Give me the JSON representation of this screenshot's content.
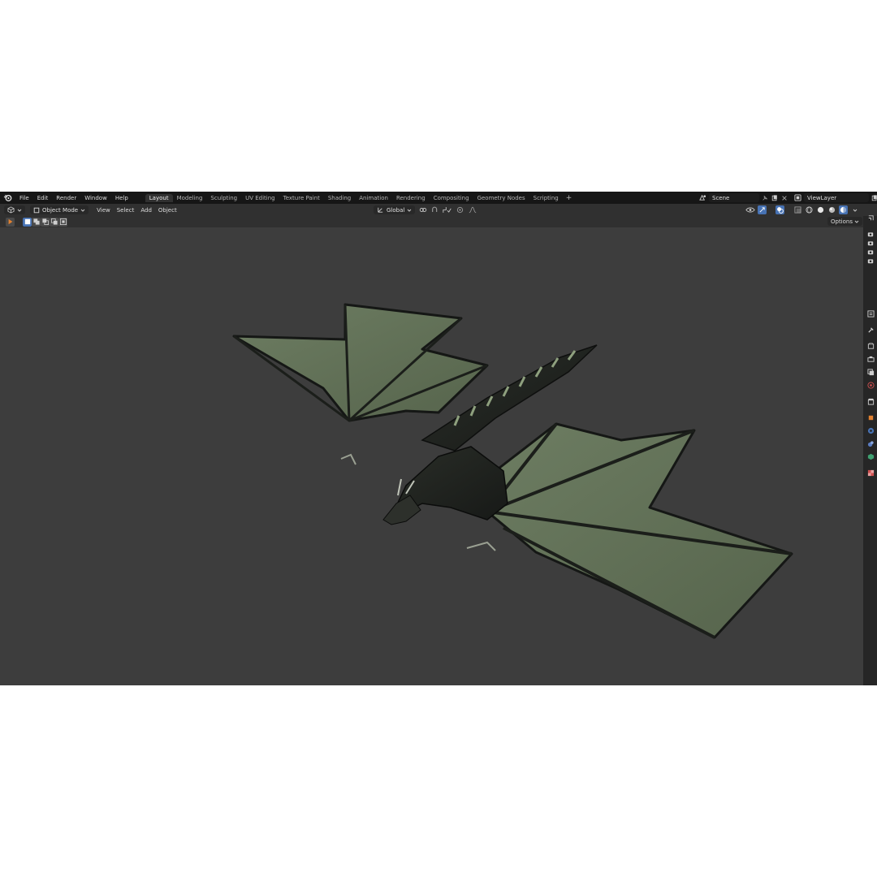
{
  "topbar": {
    "menus": [
      "File",
      "Edit",
      "Render",
      "Window",
      "Help"
    ],
    "workspaces": [
      "Layout",
      "Modeling",
      "Sculpting",
      "UV Editing",
      "Texture Paint",
      "Shading",
      "Animation",
      "Rendering",
      "Compositing",
      "Geometry Nodes",
      "Scripting"
    ],
    "active_workspace": "Layout",
    "add_workspace": "+",
    "scene": "Scene",
    "view_layer": "ViewLayer"
  },
  "header": {
    "mode": "Object Mode",
    "menus": [
      "View",
      "Select",
      "Add",
      "Object"
    ],
    "transform_orientation": "Global"
  },
  "toolrow": {
    "options_label": "Options"
  },
  "colors": {
    "topbar_bg": "#161616",
    "panel_bg": "#303030",
    "viewport_bg": "#3d3d3d",
    "accent_blue": "#4772b3",
    "wing_green": "#5f6e55"
  },
  "icons": {
    "logo": "blender-logo-icon",
    "viewport_shading": [
      "wireframe-icon",
      "solid-icon",
      "material-icon",
      "rendered-icon"
    ]
  }
}
